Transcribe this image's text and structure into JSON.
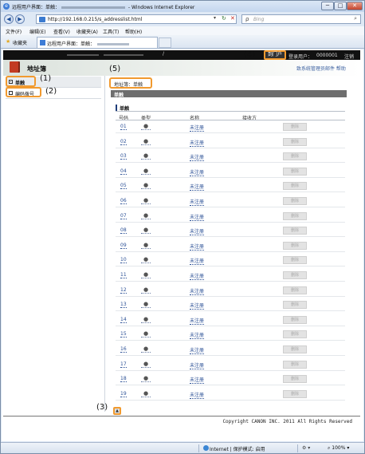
{
  "window": {
    "title_left": "远程用户界面：单触：",
    "title_right": " - Windows Internet Explorer",
    "btn_min": "─",
    "btn_max": "□",
    "btn_close": "✕"
  },
  "addressbar": {
    "url": "http://192.168.0.215/s_addresslist.html",
    "search_placeholder": "Bing"
  },
  "menu": [
    "文件(F)",
    "编辑(E)",
    "查看(V)",
    "收藏夹(A)",
    "工具(T)",
    "帮助(H)"
  ],
  "favorites": {
    "label": "收藏夹",
    "tab_title": "远程用户界面：单触："
  },
  "topbar": {
    "separator": "/",
    "portal_button": "到门户",
    "login_label": "登录用户：",
    "login_user": "0000001",
    "logout": "注销"
  },
  "header": {
    "title": "地址簿",
    "links": "致系统管理员邮件  帮助"
  },
  "sidebar": {
    "items": [
      {
        "label": "单触"
      },
      {
        "label": "编码拨号"
      }
    ]
  },
  "callouts": {
    "c1": "(1)",
    "c2": "(2)",
    "c3": "(3)",
    "c4": "(4)",
    "c5": "(5)"
  },
  "content": {
    "breadcrumb": "地址簿：单触",
    "section_title": "单触",
    "sub_title": "单触",
    "columns": {
      "number": "号码",
      "type": "类型",
      "name": "名称",
      "destination": "接收方"
    },
    "rows": [
      {
        "num": "01",
        "type": "●",
        "name": "未注册",
        "action": "删除"
      },
      {
        "num": "02",
        "type": "●",
        "name": "未注册",
        "action": "删除"
      },
      {
        "num": "03",
        "type": "●",
        "name": "未注册",
        "action": "删除"
      },
      {
        "num": "04",
        "type": "●",
        "name": "未注册",
        "action": "删除"
      },
      {
        "num": "05",
        "type": "●",
        "name": "未注册",
        "action": "删除"
      },
      {
        "num": "06",
        "type": "●",
        "name": "未注册",
        "action": "删除"
      },
      {
        "num": "07",
        "type": "●",
        "name": "未注册",
        "action": "删除"
      },
      {
        "num": "08",
        "type": "●",
        "name": "未注册",
        "action": "删除"
      },
      {
        "num": "09",
        "type": "●",
        "name": "未注册",
        "action": "删除"
      },
      {
        "num": "10",
        "type": "●",
        "name": "未注册",
        "action": "删除"
      },
      {
        "num": "11",
        "type": "●",
        "name": "未注册",
        "action": "删除"
      },
      {
        "num": "12",
        "type": "●",
        "name": "未注册",
        "action": "删除"
      },
      {
        "num": "13",
        "type": "●",
        "name": "未注册",
        "action": "删除"
      },
      {
        "num": "14",
        "type": "●",
        "name": "未注册",
        "action": "删除"
      },
      {
        "num": "15",
        "type": "●",
        "name": "未注册",
        "action": "删除"
      },
      {
        "num": "16",
        "type": "●",
        "name": "未注册",
        "action": "删除"
      },
      {
        "num": "17",
        "type": "●",
        "name": "未注册",
        "action": "删除"
      },
      {
        "num": "18",
        "type": "●",
        "name": "未注册",
        "action": "删除"
      },
      {
        "num": "19",
        "type": "●",
        "name": "未注册",
        "action": "删除"
      }
    ]
  },
  "footer": {
    "copyright": "Copyright CANON INC. 2011 All Rights Reserved"
  },
  "statusbar": {
    "zone": "Internet | 保护模式: 启用",
    "zoom": "100%"
  },
  "colors": {
    "highlight": "#f19a2f",
    "link": "#2a4f95",
    "section_bar": "#6e6e6e"
  }
}
